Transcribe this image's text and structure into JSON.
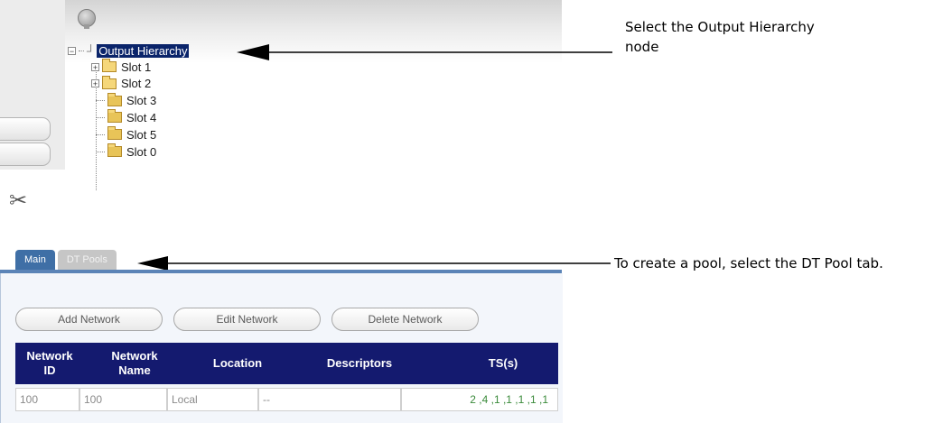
{
  "tree": {
    "root_label": "Output Hierarchy",
    "items": [
      {
        "label": "Slot 1",
        "expandable": true
      },
      {
        "label": "Slot 2",
        "expandable": true
      },
      {
        "label": "Slot 3",
        "expandable": false
      },
      {
        "label": "Slot 4",
        "expandable": false
      },
      {
        "label": "Slot 5",
        "expandable": false
      },
      {
        "label": "Slot 0",
        "expandable": false
      }
    ]
  },
  "annotations": {
    "top_line1": "Select the Output Hierarchy",
    "top_line2": "node",
    "bottom": "To create a pool, select the DT Pool tab."
  },
  "tabs": {
    "main": "Main",
    "dt_pools": "DT Pools"
  },
  "buttons": {
    "add_network": "Add Network",
    "edit_network": "Edit Network",
    "delete_network": "Delete Network"
  },
  "table": {
    "headers": {
      "network_id_1": "Network",
      "network_id_2": "ID",
      "network_name_1": "Network",
      "network_name_2": "Name",
      "location": "Location",
      "descriptors": "Descriptors",
      "ts": "TS(s)"
    },
    "rows": [
      {
        "network_id": "100",
        "network_name": "100",
        "location": "Local",
        "descriptors": "--",
        "ts": "2 ,4 ,1 ,1 ,1 ,1 ,1"
      }
    ]
  },
  "colors": {
    "header_bg": "#141a6f",
    "tab_active": "#3f6fa6",
    "selection": "#0a246a",
    "ts_text": "#3a8a3a"
  },
  "icons": [
    "bulb-icon",
    "expand-icon",
    "folder-icon",
    "folder-open-icon",
    "root-node-icon",
    "scissors-icon"
  ]
}
